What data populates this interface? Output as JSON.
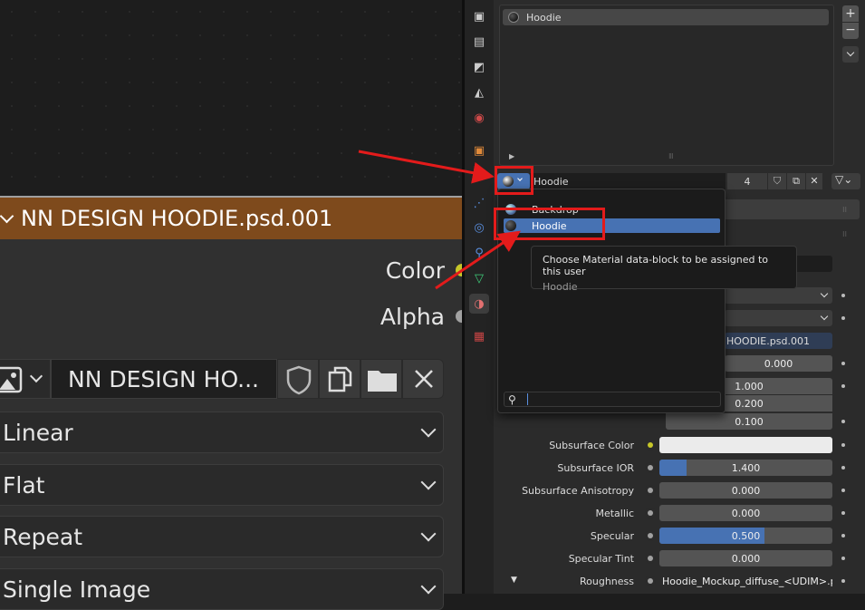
{
  "node": {
    "header_title": "NN DESIGN HOODIE.psd.001",
    "socket_color": "Color",
    "socket_alpha": "Alpha",
    "image_name": "NN DESIGN HO...",
    "interpolation": "Linear",
    "projection": "Flat",
    "extension": "Repeat",
    "source": "Single Image"
  },
  "slots": {
    "items": [
      "Hoodie"
    ],
    "count_users": "4"
  },
  "material_picker": {
    "current": "Hoodie",
    "dropdown_items": [
      "Backdrop",
      "Hoodie"
    ],
    "selected": "Hoodie",
    "search_value": ""
  },
  "tooltip": {
    "title": "Choose Material data-block to be assigned to this user",
    "subtitle": "Hoodie"
  },
  "partial_fields": {
    "image_texture": "HOODIE.psd.001",
    "v1": "0.000",
    "v2": "1.000",
    "v3": "0.200",
    "v4": "0.100"
  },
  "bsdf_rows": [
    {
      "label": "Subsurface Color",
      "value": ""
    },
    {
      "label": "Subsurface IOR",
      "value": "1.400",
      "fill": 0.05
    },
    {
      "label": "Subsurface Anisotropy",
      "value": "0.000"
    },
    {
      "label": "Metallic",
      "value": "0.000"
    },
    {
      "label": "Specular",
      "value": "0.500",
      "fill": 0.5
    },
    {
      "label": "Specular Tint",
      "value": "0.000"
    },
    {
      "label": "Roughness",
      "value": "Hoodie_Mockup_diffuse_<UDIM>.png"
    }
  ],
  "colors": {
    "accent": "#4772b3",
    "node_header": "#7e4a1c",
    "annotation": "#e31b1b"
  }
}
